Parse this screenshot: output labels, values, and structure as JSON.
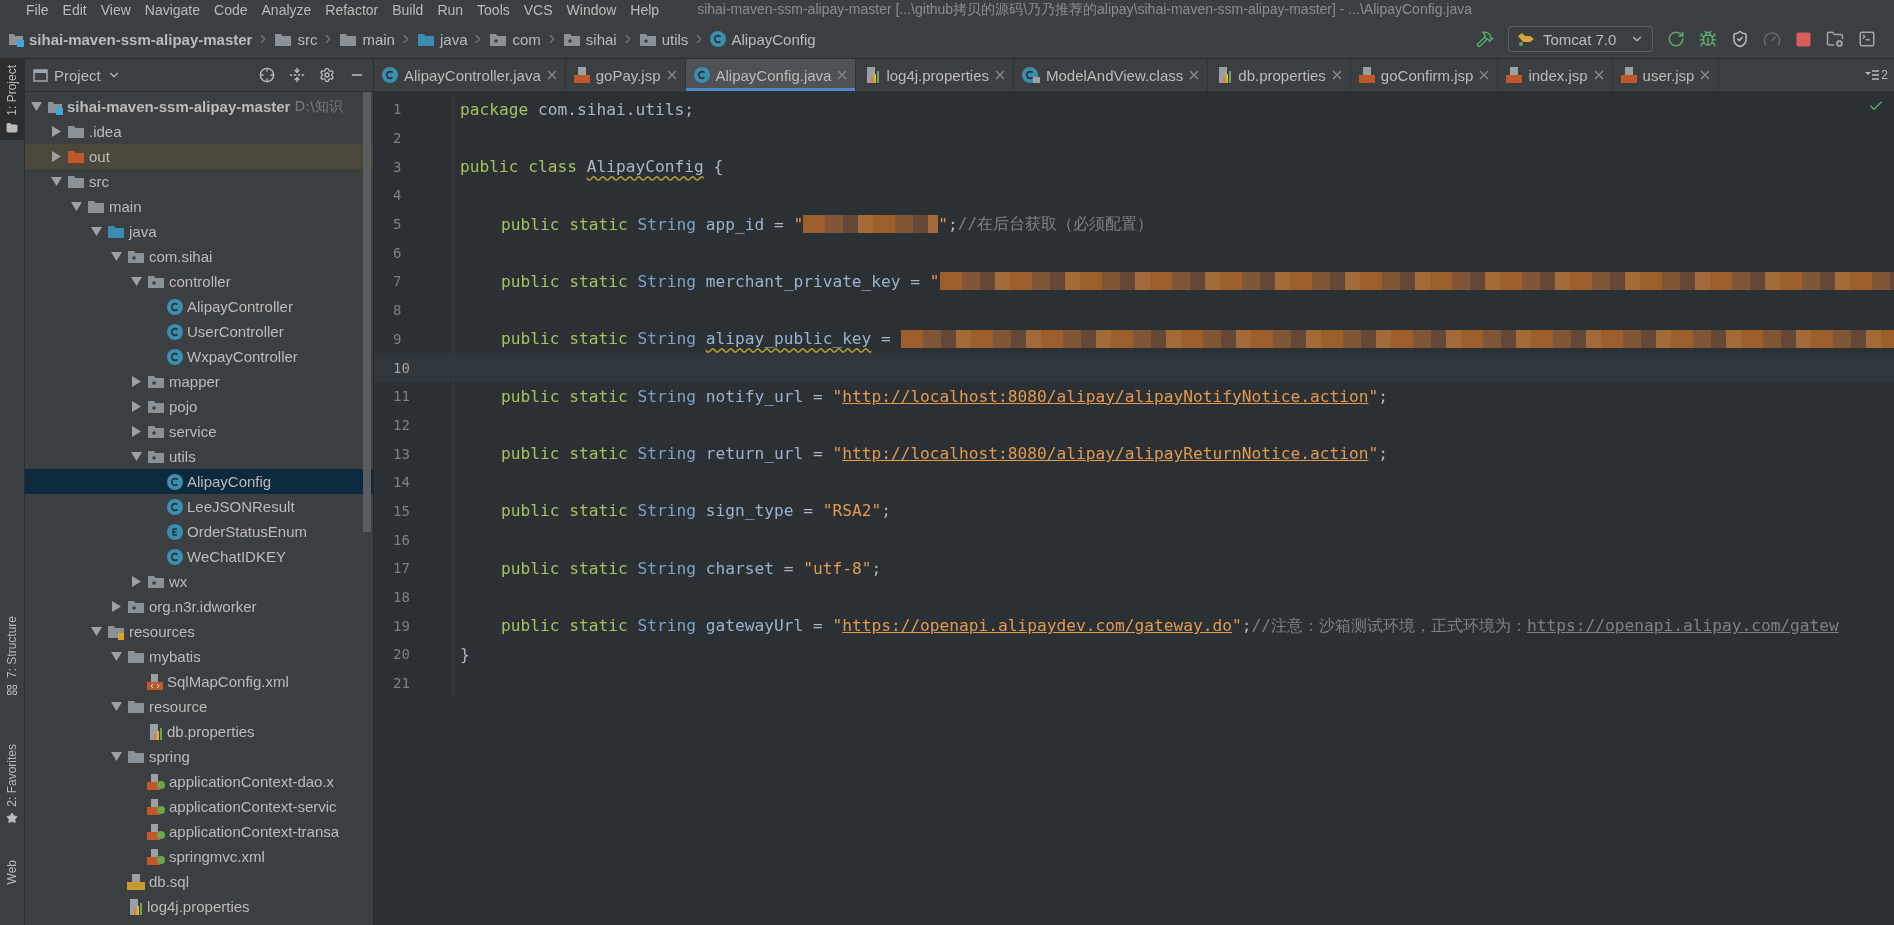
{
  "menu": {
    "items": [
      "File",
      "Edit",
      "View",
      "Navigate",
      "Code",
      "Analyze",
      "Refactor",
      "Build",
      "Run",
      "Tools",
      "VCS",
      "Window",
      "Help"
    ],
    "title": "sihai-maven-ssm-alipay-master [...\\github拷贝的源码\\乃乃推荐的alipay\\sihai-maven-ssm-alipay-master] - ...\\AlipayConfig.java"
  },
  "breadcrumbs": [
    {
      "label": "sihai-maven-ssm-alipay-master",
      "kind": "module"
    },
    {
      "label": "src",
      "kind": "folder"
    },
    {
      "label": "main",
      "kind": "folder"
    },
    {
      "label": "java",
      "kind": "source-folder"
    },
    {
      "label": "com",
      "kind": "package"
    },
    {
      "label": "sihai",
      "kind": "package"
    },
    {
      "label": "utils",
      "kind": "package"
    },
    {
      "label": "AlipayConfig",
      "kind": "class"
    }
  ],
  "run_config": {
    "label": "Tomcat 7.0"
  },
  "tool_strip": [
    {
      "label": "1: Project",
      "selected": true,
      "kind": "project"
    },
    {
      "label": "7: Structure",
      "selected": false,
      "kind": "structure"
    },
    {
      "label": "2: Favorites",
      "selected": false,
      "kind": "favorites"
    },
    {
      "label": "Web",
      "selected": false,
      "kind": "web"
    }
  ],
  "project_panel": {
    "title": "Project",
    "tree": [
      {
        "label": "sihai-maven-ssm-alipay-master",
        "hint": "D:\\知识",
        "kind": "module",
        "expanded": true,
        "selected": false,
        "children": [
          {
            "label": ".idea",
            "kind": "folder",
            "expanded": false,
            "selected": false
          },
          {
            "label": "out",
            "kind": "excluded-folder",
            "expanded": false,
            "selected": false
          },
          {
            "label": "src",
            "kind": "folder",
            "expanded": true,
            "selected": false,
            "children": [
              {
                "label": "main",
                "kind": "folder",
                "expanded": true,
                "selected": false,
                "children": [
                  {
                    "label": "java",
                    "kind": "source-folder",
                    "expanded": true,
                    "selected": false,
                    "children": [
                      {
                        "label": "com.sihai",
                        "kind": "package",
                        "expanded": true,
                        "selected": false,
                        "children": [
                          {
                            "label": "controller",
                            "kind": "package",
                            "expanded": true,
                            "selected": false,
                            "children": [
                              {
                                "label": "AlipayController",
                                "kind": "class",
                                "selected": false
                              },
                              {
                                "label": "UserController",
                                "kind": "class",
                                "selected": false
                              },
                              {
                                "label": "WxpayController",
                                "kind": "class",
                                "selected": false
                              }
                            ]
                          },
                          {
                            "label": "mapper",
                            "kind": "package",
                            "expanded": false,
                            "selected": false
                          },
                          {
                            "label": "pojo",
                            "kind": "package",
                            "expanded": false,
                            "selected": false
                          },
                          {
                            "label": "service",
                            "kind": "package",
                            "expanded": false,
                            "selected": false
                          },
                          {
                            "label": "utils",
                            "kind": "package",
                            "expanded": true,
                            "selected": false,
                            "children": [
                              {
                                "label": "AlipayConfig",
                                "kind": "class",
                                "selected": true
                              },
                              {
                                "label": "LeeJSONResult",
                                "kind": "class",
                                "selected": false
                              },
                              {
                                "label": "OrderStatusEnum",
                                "kind": "enum",
                                "selected": false
                              },
                              {
                                "label": "WeChatIDKEY",
                                "kind": "class",
                                "selected": false
                              }
                            ]
                          },
                          {
                            "label": "wx",
                            "kind": "package",
                            "expanded": false,
                            "selected": false
                          }
                        ]
                      },
                      {
                        "label": "org.n3r.idworker",
                        "kind": "package",
                        "expanded": false,
                        "selected": false
                      }
                    ]
                  },
                  {
                    "label": "resources",
                    "kind": "resources-folder",
                    "expanded": true,
                    "selected": false,
                    "children": [
                      {
                        "label": "mybatis",
                        "kind": "folder",
                        "expanded": true,
                        "selected": false,
                        "children": [
                          {
                            "label": "SqlMapConfig.xml",
                            "kind": "xml",
                            "selected": false
                          }
                        ]
                      },
                      {
                        "label": "resource",
                        "kind": "folder",
                        "expanded": true,
                        "selected": false,
                        "children": [
                          {
                            "label": "db.properties",
                            "kind": "properties",
                            "selected": false
                          }
                        ]
                      },
                      {
                        "label": "spring",
                        "kind": "folder",
                        "expanded": true,
                        "selected": false,
                        "children": [
                          {
                            "label": "applicationContext-dao.x",
                            "kind": "spring-xml",
                            "selected": false
                          },
                          {
                            "label": "applicationContext-servic",
                            "kind": "spring-xml",
                            "selected": false
                          },
                          {
                            "label": "applicationContext-transa",
                            "kind": "spring-xml",
                            "selected": false
                          },
                          {
                            "label": "springmvc.xml",
                            "kind": "spring-xml",
                            "selected": false
                          }
                        ]
                      },
                      {
                        "label": "db.sql",
                        "kind": "sql",
                        "selected": false
                      },
                      {
                        "label": "log4j.properties",
                        "kind": "properties",
                        "selected": false
                      }
                    ]
                  }
                ]
              }
            ]
          }
        ]
      }
    ]
  },
  "tabs": [
    {
      "label": "AlipayController.java",
      "kind": "class",
      "selected": false
    },
    {
      "label": "goPay.jsp",
      "kind": "jsp",
      "selected": false
    },
    {
      "label": "AlipayConfig.java",
      "kind": "class",
      "selected": true
    },
    {
      "label": "log4j.properties",
      "kind": "properties",
      "selected": false
    },
    {
      "label": "ModelAndView.class",
      "kind": "class-file",
      "selected": false
    },
    {
      "label": "db.properties",
      "kind": "properties",
      "selected": false
    },
    {
      "label": "goConfirm.jsp",
      "kind": "jsp",
      "selected": false
    },
    {
      "label": "index.jsp",
      "kind": "jsp",
      "selected": false
    },
    {
      "label": "user.jsp",
      "kind": "jsp",
      "selected": false
    }
  ],
  "tab_overflow": "2",
  "editor": {
    "lines": [
      {
        "number": "1",
        "current": false,
        "indented": false,
        "tokens": [
          {
            "kind": "keyword",
            "text": "package "
          },
          {
            "kind": "package",
            "text": "com.sihai.utils"
          },
          {
            "kind": "plain",
            "text": ";"
          }
        ]
      },
      {
        "number": "2",
        "current": false
      },
      {
        "number": "3",
        "current": false,
        "indented": false,
        "tokens": [
          {
            "kind": "keyword",
            "text": "public class "
          },
          {
            "kind": "plain",
            "text": "AlipayConfig",
            "warning": true
          },
          {
            "kind": "plain",
            "text": " {"
          }
        ]
      },
      {
        "number": "4",
        "current": false
      },
      {
        "number": "5",
        "current": false,
        "indented": true,
        "tokens": [
          {
            "kind": "keyword",
            "text": "public static "
          },
          {
            "kind": "type",
            "text": "String "
          },
          {
            "kind": "field",
            "text": "app_id"
          },
          {
            "kind": "plain",
            "text": " = "
          },
          {
            "kind": "string",
            "text": "\""
          },
          {
            "kind": "redacted"
          },
          {
            "kind": "string",
            "text": "\""
          },
          {
            "kind": "plain",
            "text": ";"
          },
          {
            "kind": "comment",
            "text": "//在后台获取（必须配置）"
          }
        ]
      },
      {
        "number": "6",
        "current": false
      },
      {
        "number": "7",
        "current": false,
        "indented": true,
        "tokens": [
          {
            "kind": "keyword",
            "text": "public static "
          },
          {
            "kind": "type",
            "text": "String "
          },
          {
            "kind": "field",
            "text": "merchant_private_key"
          },
          {
            "kind": "plain",
            "text": " = "
          },
          {
            "kind": "string",
            "text": "\""
          },
          {
            "kind": "redacted"
          }
        ]
      },
      {
        "number": "8",
        "current": false
      },
      {
        "number": "9",
        "current": false,
        "indented": true,
        "tokens": [
          {
            "kind": "keyword",
            "text": "public static "
          },
          {
            "kind": "type",
            "text": "String "
          },
          {
            "kind": "field",
            "text": "alipay_public_key",
            "warning": true
          },
          {
            "kind": "plain",
            "text": " = "
          },
          {
            "kind": "redacted"
          }
        ]
      },
      {
        "number": "10",
        "current": true
      },
      {
        "number": "11",
        "current": false,
        "indented": true,
        "tokens": [
          {
            "kind": "keyword",
            "text": "public static "
          },
          {
            "kind": "type",
            "text": "String "
          },
          {
            "kind": "field",
            "text": "notify_url"
          },
          {
            "kind": "plain",
            "text": " = "
          },
          {
            "kind": "string",
            "text": "\""
          },
          {
            "kind": "link",
            "text": "http://localhost:8080/alipay/alipayNotifyNotice.action"
          },
          {
            "kind": "string",
            "text": "\""
          },
          {
            "kind": "plain",
            "text": ";"
          }
        ]
      },
      {
        "number": "12",
        "current": false
      },
      {
        "number": "13",
        "current": false,
        "indented": true,
        "tokens": [
          {
            "kind": "keyword",
            "text": "public static "
          },
          {
            "kind": "type",
            "text": "String "
          },
          {
            "kind": "field",
            "text": "return_url"
          },
          {
            "kind": "plain",
            "text": " = "
          },
          {
            "kind": "string",
            "text": "\""
          },
          {
            "kind": "link",
            "text": "http://localhost:8080/alipay/alipayReturnNotice.action"
          },
          {
            "kind": "string",
            "text": "\""
          },
          {
            "kind": "plain",
            "text": ";"
          }
        ]
      },
      {
        "number": "14",
        "current": false
      },
      {
        "number": "15",
        "current": false,
        "indented": true,
        "tokens": [
          {
            "kind": "keyword",
            "text": "public static "
          },
          {
            "kind": "type",
            "text": "String "
          },
          {
            "kind": "field",
            "text": "sign_type"
          },
          {
            "kind": "plain",
            "text": " = "
          },
          {
            "kind": "string",
            "text": "\"RSA2\""
          },
          {
            "kind": "plain",
            "text": ";"
          }
        ]
      },
      {
        "number": "16",
        "current": false
      },
      {
        "number": "17",
        "current": false,
        "indented": true,
        "tokens": [
          {
            "kind": "keyword",
            "text": "public static "
          },
          {
            "kind": "type",
            "text": "String "
          },
          {
            "kind": "field",
            "text": "charset"
          },
          {
            "kind": "plain",
            "text": " = "
          },
          {
            "kind": "string",
            "text": "\"utf-8\""
          },
          {
            "kind": "plain",
            "text": ";"
          }
        ]
      },
      {
        "number": "18",
        "current": false
      },
      {
        "number": "19",
        "current": false,
        "indented": true,
        "tokens": [
          {
            "kind": "keyword",
            "text": "public static "
          },
          {
            "kind": "type",
            "text": "String "
          },
          {
            "kind": "field",
            "text": "gatewayUrl"
          },
          {
            "kind": "plain",
            "text": " = "
          },
          {
            "kind": "string",
            "text": "\""
          },
          {
            "kind": "link",
            "text": "https://openapi.alipaydev.com/gateway.do"
          },
          {
            "kind": "string",
            "text": "\""
          },
          {
            "kind": "plain",
            "text": ";"
          },
          {
            "kind": "comment",
            "text": "//注意：沙箱测试环境，正式环境为："
          },
          {
            "kind": "comment-link",
            "text": "https://openapi.alipay.com/gatew"
          }
        ]
      },
      {
        "number": "20",
        "current": false,
        "indented": false,
        "tokens": [
          {
            "kind": "plain",
            "text": "}"
          }
        ]
      },
      {
        "number": "21",
        "current": false
      }
    ]
  }
}
